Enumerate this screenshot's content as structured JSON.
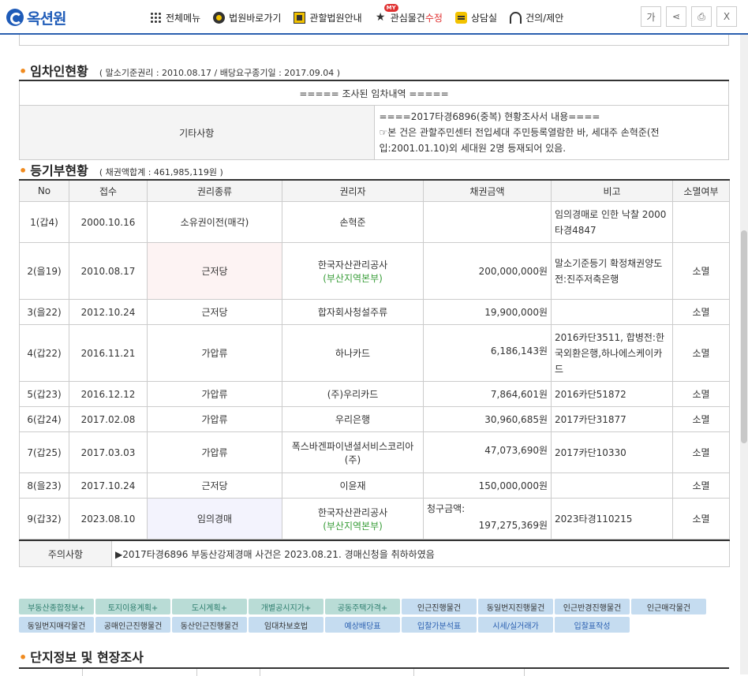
{
  "logo": {
    "text": "옥션원"
  },
  "nav": [
    {
      "label": "전체메뉴",
      "icon": "grid-icon"
    },
    {
      "label": "법원바로가기",
      "icon": "gavel-icon"
    },
    {
      "label": "관할법원안내",
      "icon": "court-icon"
    },
    {
      "label_a": "관심물건",
      "label_b": "수정",
      "badge": "MY",
      "icon": "star-icon"
    },
    {
      "label": "상담실",
      "icon": "chat-icon"
    },
    {
      "label": "건의/제안",
      "icon": "headset-icon"
    }
  ],
  "tools": {
    "font": "가",
    "share": "⋖",
    "print": "⎙",
    "close": "X"
  },
  "tenant": {
    "title": "임차인현황",
    "subtitle": "( 말소기준권리 : 2010.08.17 / 배당요구종기일 : 2017.09.04 )",
    "header": "===== 조사된 임차내역 =====",
    "label": "기타사항",
    "note_line1": "====2017타경6896(중복) 현황조사서 내용====",
    "note_line2": "☞본 건은 관할주민센터 전입세대 주민등록열람한 바, 세대주 손혁준(전입:2001.01.10)외 세대원 2명 등재되어 있음."
  },
  "registry": {
    "title": "등기부현황",
    "subtitle": "( 채권액합계 : 461,985,119원 )",
    "columns": [
      "No",
      "접수",
      "권리종류",
      "권리자",
      "채권금액",
      "비고",
      "소멸여부"
    ],
    "rows": [
      {
        "no": "1(갑4)",
        "date": "2000.10.16",
        "type": "소유권이전(매각)",
        "holder": "손혁준",
        "holder_sub": "",
        "amount": "",
        "remark": "임의경매로 인한 낙찰 2000타경4847",
        "status": ""
      },
      {
        "no": "2(을19)",
        "date": "2010.08.17",
        "type": "근저당",
        "holder": "한국자산관리공사",
        "holder_sub": "(부산지역본부)",
        "amount": "200,000,000원",
        "remark": "말소기준등기 확정채권양도전:진주저축은행",
        "status": "소멸"
      },
      {
        "no": "3(을22)",
        "date": "2012.10.24",
        "type": "근저당",
        "holder": "합자회사청설주류",
        "holder_sub": "",
        "amount": "19,900,000원",
        "remark": "",
        "status": "소멸"
      },
      {
        "no": "4(갑22)",
        "date": "2016.11.21",
        "type": "가압류",
        "holder": "하나카드",
        "holder_sub": "",
        "amount": "6,186,143원",
        "remark": "2016카단3511, 합병전:한국외환은행,하나에스케이카드",
        "status": "소멸"
      },
      {
        "no": "5(갑23)",
        "date": "2016.12.12",
        "type": "가압류",
        "holder": "(주)우리카드",
        "holder_sub": "",
        "amount": "7,864,601원",
        "remark": "2016카단51872",
        "status": "소멸"
      },
      {
        "no": "6(갑24)",
        "date": "2017.02.08",
        "type": "가압류",
        "holder": "우리은행",
        "holder_sub": "",
        "amount": "30,960,685원",
        "remark": "2017카단31877",
        "status": "소멸"
      },
      {
        "no": "7(갑25)",
        "date": "2017.03.03",
        "type": "가압류",
        "holder": "폭스바겐파이낸셜서비스코리아(주)",
        "holder_sub": "",
        "amount": "47,073,690원",
        "remark": "2017카단10330",
        "status": "소멸"
      },
      {
        "no": "8(을23)",
        "date": "2017.10.24",
        "type": "근저당",
        "holder": "이윤재",
        "holder_sub": "",
        "amount": "150,000,000원",
        "remark": "",
        "status": "소멸"
      },
      {
        "no": "9(갑32)",
        "date": "2023.08.10",
        "type": "임의경매",
        "holder": "한국자산관리공사",
        "holder_sub": "(부산지역본부)",
        "amount_label": "청구금액:",
        "amount": "197,275,369원",
        "remark": "2023타경110215",
        "status": "소멸"
      }
    ]
  },
  "caution": {
    "label": "주의사항",
    "text": "▶2017타경6896 부동산강제경매 사건은 2023.08.21. 경매신청을 취하하였음"
  },
  "buttons": [
    {
      "label": "부동산종합정보+",
      "style": "g"
    },
    {
      "label": "토지이용계획+",
      "style": "g"
    },
    {
      "label": "도시계획+",
      "style": "g"
    },
    {
      "label": "개별공시지가+",
      "style": "g"
    },
    {
      "label": "공동주택가격+",
      "style": "g"
    },
    {
      "label": "인근진행물건",
      "style": "b"
    },
    {
      "label": "동일번지진행물건",
      "style": "b"
    },
    {
      "label": "인근반경진행물건",
      "style": "b"
    },
    {
      "label": "인근매각물건",
      "style": "b"
    },
    {
      "label": "동일번지매각물건",
      "style": "b"
    },
    {
      "label": "공매인근진행물건",
      "style": "b"
    },
    {
      "label": "동산인근진행물건",
      "style": "b"
    },
    {
      "label": "임대차보호법",
      "style": "b"
    },
    {
      "label": "예상배당표",
      "style": "lb"
    },
    {
      "label": "입찰가분석표",
      "style": "lb"
    },
    {
      "label": "시세/실거래가",
      "style": "lb"
    },
    {
      "label": "입찰표작성",
      "style": "lb"
    }
  ],
  "complex": {
    "title": "단지정보 및 현장조사"
  },
  "colors": {
    "accent": "#2a5fb0",
    "bullet": "#f08a1e",
    "green": "#3a9e3a",
    "red": "#e03030"
  }
}
